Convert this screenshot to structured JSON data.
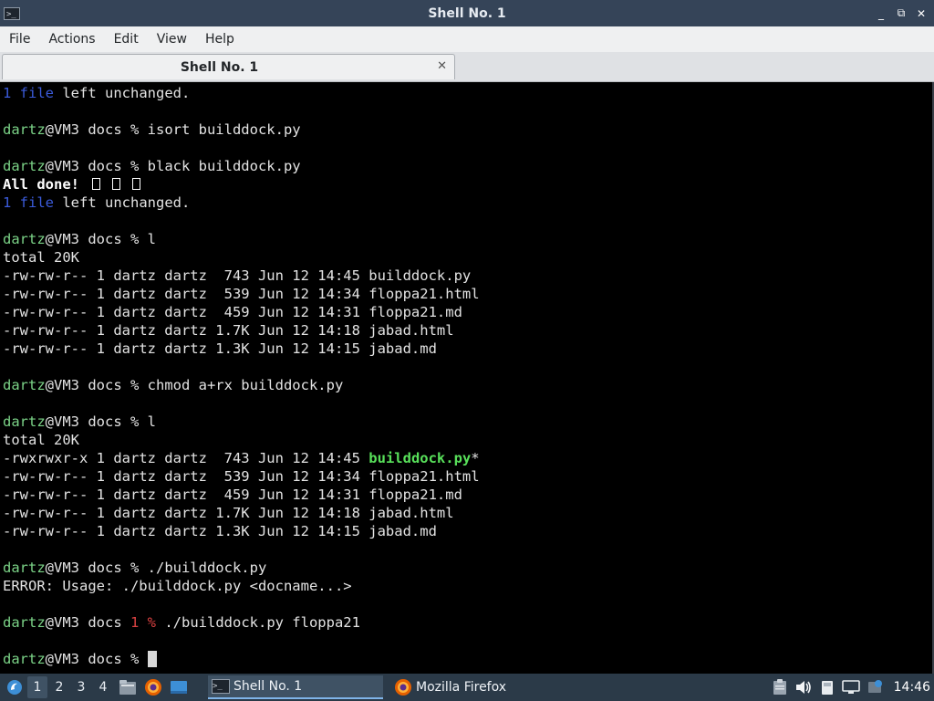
{
  "window": {
    "title": "Shell No. 1",
    "buttons": [
      "_",
      "⧉",
      "✕"
    ]
  },
  "menu": [
    "File",
    "Actions",
    "Edit",
    "View",
    "Help"
  ],
  "tab": {
    "label": "Shell No. 1",
    "close": "✕"
  },
  "terminal": {
    "lines": [
      [
        {
          "t": "1 file",
          "c": "blue"
        },
        {
          "t": " left unchanged."
        }
      ],
      [],
      [
        {
          "t": "dartz",
          "c": "green"
        },
        {
          "t": "@VM3 docs % isort builddock.py"
        }
      ],
      [],
      [
        {
          "t": "dartz",
          "c": "green"
        },
        {
          "t": "@VM3 docs % black builddock.py"
        }
      ],
      [
        {
          "t": "All done! ",
          "c": "bold"
        },
        {
          "t": "",
          "g": "box"
        },
        {
          "t": "",
          "g": "box"
        },
        {
          "t": "",
          "g": "box"
        }
      ],
      [
        {
          "t": "1 file",
          "c": "blue"
        },
        {
          "t": " left unchanged."
        }
      ],
      [],
      [
        {
          "t": "dartz",
          "c": "green"
        },
        {
          "t": "@VM3 docs % l"
        }
      ],
      [
        {
          "t": "total 20K"
        }
      ],
      [
        {
          "t": "-rw-rw-r-- 1 dartz dartz  743 Jun 12 14:45 builddock.py"
        }
      ],
      [
        {
          "t": "-rw-rw-r-- 1 dartz dartz  539 Jun 12 14:34 floppa21.html"
        }
      ],
      [
        {
          "t": "-rw-rw-r-- 1 dartz dartz  459 Jun 12 14:31 floppa21.md"
        }
      ],
      [
        {
          "t": "-rw-rw-r-- 1 dartz dartz 1.7K Jun 12 14:18 jabad.html"
        }
      ],
      [
        {
          "t": "-rw-rw-r-- 1 dartz dartz 1.3K Jun 12 14:15 jabad.md"
        }
      ],
      [],
      [
        {
          "t": "dartz",
          "c": "green"
        },
        {
          "t": "@VM3 docs % chmod a+rx builddock.py"
        }
      ],
      [],
      [
        {
          "t": "dartz",
          "c": "green"
        },
        {
          "t": "@VM3 docs % l"
        }
      ],
      [
        {
          "t": "total 20K"
        }
      ],
      [
        {
          "t": "-rwxrwxr-x 1 dartz dartz  743 Jun 12 14:45 "
        },
        {
          "t": "builddock.py",
          "c": "exec"
        },
        {
          "t": "*"
        }
      ],
      [
        {
          "t": "-rw-rw-r-- 1 dartz dartz  539 Jun 12 14:34 floppa21.html"
        }
      ],
      [
        {
          "t": "-rw-rw-r-- 1 dartz dartz  459 Jun 12 14:31 floppa21.md"
        }
      ],
      [
        {
          "t": "-rw-rw-r-- 1 dartz dartz 1.7K Jun 12 14:18 jabad.html"
        }
      ],
      [
        {
          "t": "-rw-rw-r-- 1 dartz dartz 1.3K Jun 12 14:15 jabad.md"
        }
      ],
      [],
      [
        {
          "t": "dartz",
          "c": "green"
        },
        {
          "t": "@VM3 docs % ./builddock.py"
        }
      ],
      [
        {
          "t": "ERROR: Usage: ./builddock.py <docname...>"
        }
      ],
      [],
      [
        {
          "t": "dartz",
          "c": "green"
        },
        {
          "t": "@VM3 docs "
        },
        {
          "t": "1 %",
          "c": "red"
        },
        {
          "t": " ./builddock.py floppa21"
        }
      ],
      [],
      [
        {
          "t": "dartz",
          "c": "green"
        },
        {
          "t": "@VM3 docs % "
        },
        {
          "t": "",
          "g": "cursor"
        }
      ]
    ]
  },
  "taskbar": {
    "workspaces": [
      "1",
      "2",
      "3",
      "4"
    ],
    "active_workspace": "1",
    "quicklaunch": [
      "file-manager-icon",
      "firefox-icon",
      "desktop-icon"
    ],
    "tasks": [
      {
        "label": "Shell No. 1",
        "icon": "terminal-icon",
        "active": true
      },
      {
        "label": "Mozilla Firefox",
        "icon": "firefox-icon",
        "active": false
      }
    ],
    "tray": [
      "clipboard-icon",
      "volume-icon",
      "removable-media-icon",
      "network-icon",
      "update-icon"
    ],
    "clock": "14:46"
  },
  "colors": {
    "titlebar": "#354458",
    "taskbar": "#2b3a48",
    "prompt_user": "#7bd387",
    "file_word": "#3b5bdb",
    "exit_code": "#d94141",
    "executable": "#58e05a"
  }
}
